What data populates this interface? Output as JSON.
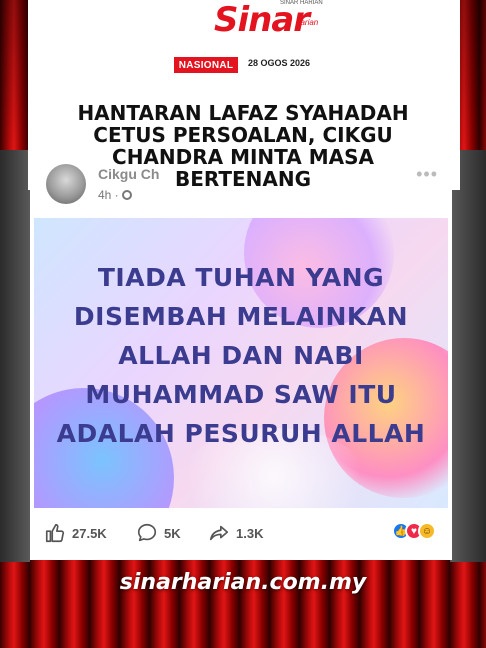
{
  "brand": {
    "logo_text": "Sinar",
    "logo_small": "SINAR HARIAN",
    "logo_sub": "harian",
    "accent_color": "#e3141f"
  },
  "article": {
    "category": "NASIONAL",
    "date": "28 OGOS 2026",
    "headline": "HANTARAN LAFAZ SYAHADAH CETUS PERSOALAN, CIKGU CHANDRA MINTA MASA BERTENANG"
  },
  "post": {
    "author": "Cikgu Ch",
    "time": "4h ·",
    "image_text": "TIADA TUHAN YANG DISEMBAH MELAINKAN ALLAH DAN NABI MUHAMMAD SAW ITU ADALAH PESURUH ALLAH",
    "likes": "27.5K",
    "comments": "5K",
    "shares": "1.3K",
    "icons": [
      "like-icon",
      "comment-icon",
      "share-icon",
      "globe-icon",
      "more-icon"
    ]
  },
  "footer": {
    "url": "sinarharian.com.my"
  }
}
